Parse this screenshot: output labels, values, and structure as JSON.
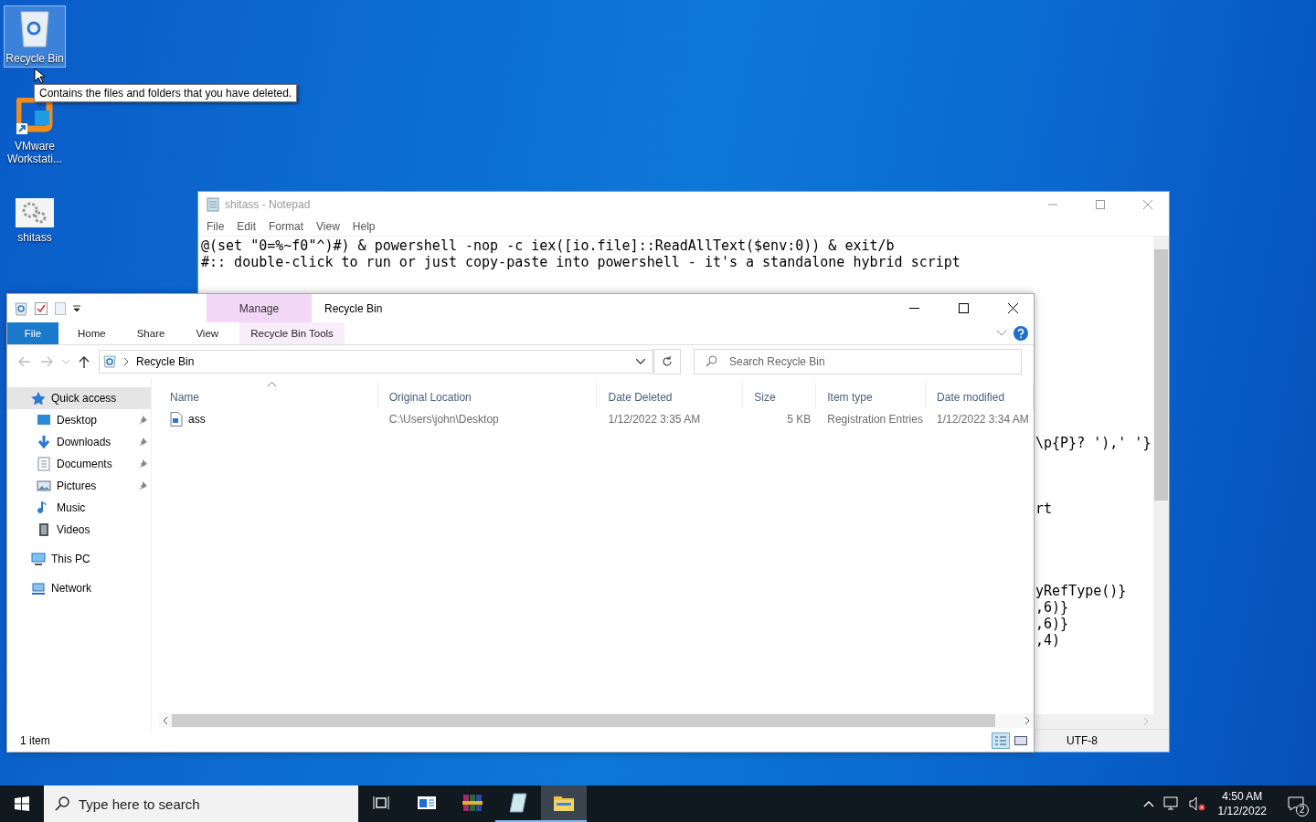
{
  "desktop": {
    "icons": [
      {
        "label": "Recycle Bin",
        "selected": true,
        "kind": "recycle"
      },
      {
        "label": "VMware Workstati...",
        "selected": false,
        "kind": "vmware"
      },
      {
        "label": "shitass",
        "selected": false,
        "kind": "script"
      }
    ],
    "tooltip": "Contains the files and folders that you have deleted."
  },
  "notepad": {
    "title": "shitass - Notepad",
    "menu": [
      "File",
      "Edit",
      "Format",
      "View",
      "Help"
    ],
    "lines": [
      "@(set \"0=%~f0\"^)#) & powershell -nop -c iex([io.file]::ReadAllText($env:0)) & exit/b",
      "#:: double-click to run or just copy-paste into powershell - it's a standalone hybrid script"
    ],
    "clipped_lines": [
      "\\p{P}? '),' '}",
      "rt",
      "yRefType()}",
      ",6)}",
      ",6)}",
      ",4)"
    ],
    "encoding": "UTF-8"
  },
  "explorer": {
    "title": "Recycle Bin",
    "context_group": "Manage",
    "tabs": [
      {
        "label": "File",
        "kind": "file"
      },
      {
        "label": "Home",
        "kind": "plain"
      },
      {
        "label": "Share",
        "kind": "plain"
      },
      {
        "label": "View",
        "kind": "plain"
      },
      {
        "label": "Recycle Bin Tools",
        "kind": "context"
      }
    ],
    "address": "Recycle Bin",
    "search_placeholder": "Search Recycle Bin",
    "nav": [
      {
        "label": "Quick access",
        "kind": "star",
        "selected": true,
        "children": [
          {
            "label": "Desktop",
            "kind": "desktop",
            "pinned": true,
            "selected": false
          },
          {
            "label": "Downloads",
            "kind": "downloads",
            "pinned": true,
            "selected": false
          },
          {
            "label": "Documents",
            "kind": "documents",
            "pinned": true,
            "selected": false
          },
          {
            "label": "Pictures",
            "kind": "pictures",
            "pinned": true,
            "selected": false
          },
          {
            "label": "Music",
            "kind": "music",
            "pinned": false,
            "selected": false
          },
          {
            "label": "Videos",
            "kind": "videos",
            "pinned": false,
            "selected": false
          }
        ]
      },
      {
        "label": "This PC",
        "kind": "pc",
        "selected": false
      },
      {
        "label": "Network",
        "kind": "network",
        "selected": false
      }
    ],
    "columns": [
      {
        "label": "Name",
        "sorted": true
      },
      {
        "label": "Original Location",
        "sorted": false
      },
      {
        "label": "Date Deleted",
        "sorted": false
      },
      {
        "label": "Size",
        "sorted": false
      },
      {
        "label": "Item type",
        "sorted": false
      },
      {
        "label": "Date modified",
        "sorted": false
      }
    ],
    "rows": [
      {
        "cells": [
          "ass",
          "C:\\Users\\john\\Desktop",
          "1/12/2022 3:35 AM",
          "5 KB",
          "Registration Entries",
          "1/12/2022 3:34 AM"
        ],
        "selected": false
      }
    ],
    "status": "1 item"
  },
  "taskbar": {
    "search_placeholder": "Type here to search",
    "apps": [
      {
        "kind": "taskview",
        "running": false,
        "active": false
      },
      {
        "kind": "news",
        "running": false,
        "active": false
      },
      {
        "kind": "archiver",
        "running": false,
        "active": false
      },
      {
        "kind": "notepad",
        "running": true,
        "active": false
      },
      {
        "kind": "folder",
        "running": true,
        "active": true
      }
    ],
    "time": "4:50 AM",
    "date": "1/12/2022",
    "notifications": "2"
  }
}
